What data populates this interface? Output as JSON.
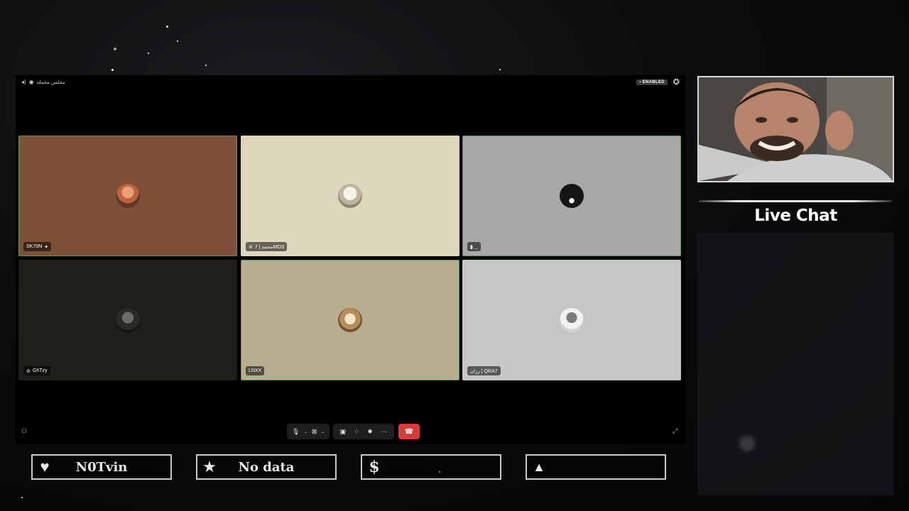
{
  "call": {
    "room_name": "مجلس محملة",
    "enabled_label": "ENABLED"
  },
  "participants": [
    {
      "name": "SK70N",
      "bg": "#7e5035",
      "active": true,
      "avatar": "user-avatar-icon"
    },
    {
      "name": "محمد | 7MOS",
      "bg": "#ddd7bd",
      "active": false,
      "avatar": "cat-avatar-icon"
    },
    {
      "name": "_",
      "bg": "#a9a8a6",
      "active": true,
      "avatar": "dark-avatar-icon"
    },
    {
      "name": "GhTzy",
      "bg": "#1e1f1a",
      "active": false,
      "avatar": "knight-avatar-icon"
    },
    {
      "name": "LNXX",
      "bg": "#b8ad8e",
      "active": true,
      "avatar": "cat-avatar-icon"
    },
    {
      "name": "رزان | QRA7",
      "bg": "#c6c6c6",
      "active": false,
      "avatar": "person-avatar-icon"
    }
  ],
  "chat": {
    "title": "Live Chat"
  },
  "stats": [
    {
      "icon": "heart-icon",
      "value": "N0Tvin"
    },
    {
      "icon": "star-icon",
      "value": "No data"
    },
    {
      "icon": "dollar-icon",
      "value": ""
    },
    {
      "icon": "pyramid-icon",
      "value": ""
    }
  ]
}
